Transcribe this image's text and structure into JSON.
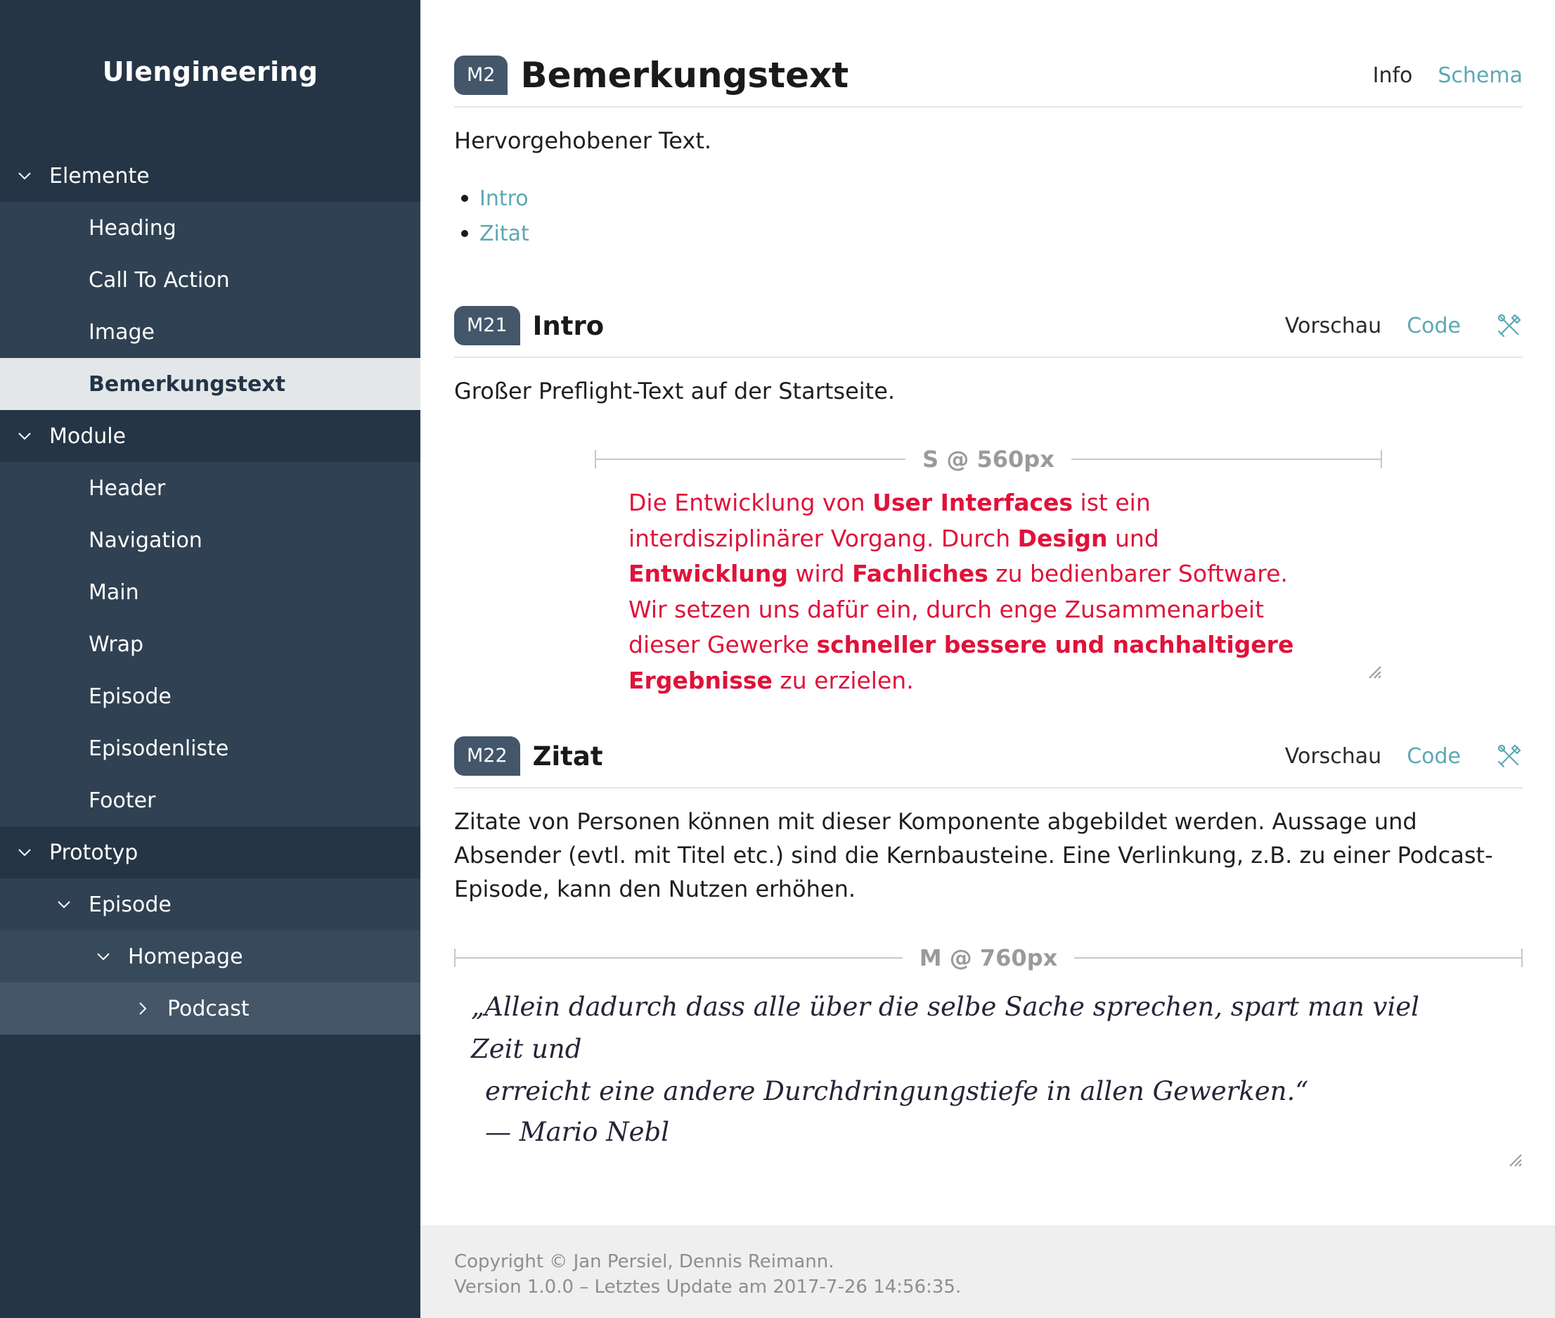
{
  "sidebar": {
    "brand": "UIengineering",
    "items": [
      {
        "label": "Elemente",
        "level": 0,
        "chevron": "down"
      },
      {
        "label": "Heading",
        "level": 1
      },
      {
        "label": "Call To Action",
        "level": 1
      },
      {
        "label": "Image",
        "level": 1
      },
      {
        "label": "Bemerkungstext",
        "level": 1,
        "active": true
      },
      {
        "label": "Module",
        "level": 0,
        "chevron": "down"
      },
      {
        "label": "Header",
        "level": 1
      },
      {
        "label": "Navigation",
        "level": 1
      },
      {
        "label": "Main",
        "level": 1
      },
      {
        "label": "Wrap",
        "level": 1
      },
      {
        "label": "Episode",
        "level": 1
      },
      {
        "label": "Episodenliste",
        "level": 1
      },
      {
        "label": "Footer",
        "level": 1
      },
      {
        "label": "Prototyp",
        "level": 0,
        "chevron": "down"
      },
      {
        "label": "Episode",
        "level": 1,
        "chevron": "down"
      },
      {
        "label": "Homepage",
        "level": 2,
        "chevron": "down"
      },
      {
        "label": "Podcast",
        "level": 3,
        "chevron": "right"
      }
    ]
  },
  "page": {
    "badge": "M2",
    "title": "Bemerkungstext",
    "tab_info": "Info",
    "tab_schema": "Schema",
    "description": "Hervorgehobener Text.",
    "toc": [
      "Intro",
      "Zitat"
    ]
  },
  "intro": {
    "badge": "M21",
    "title": "Intro",
    "preview_label": "Vorschau",
    "code_label": "Code",
    "tool_icon": "tools-icon",
    "description": "Großer Preflight-Text auf der Startseite.",
    "size_label": "S @ 560px",
    "preview": {
      "p1": "Die Entwicklung von ",
      "b1": "User Interfaces",
      "p2": " ist ein interdisziplinärer Vorgang. Durch ",
      "b2": "Design",
      "p3": " und ",
      "b3": "Entwicklung",
      "p4": " wird ",
      "b4": "Fachliches",
      "p5": " zu bedienbarer Software. Wir setzen uns dafür ein, durch enge Zusammenarbeit dieser Gewerke ",
      "b5": "schneller bessere und nachhaltigere Ergebnisse",
      "p6": " zu erzielen."
    }
  },
  "zitat": {
    "badge": "M22",
    "title": "Zitat",
    "preview_label": "Vorschau",
    "code_label": "Code",
    "tool_icon": "tools-icon",
    "description": "Zitate von Personen können mit dieser Komponente abgebildet werden. Aussage und Absender (evtl. mit Titel etc.) sind die Kernbausteine. Eine Verlinkung, z.B. zu einer Podcast-Episode, kann den Nutzen erhöhen.",
    "size_label": "M @ 760px",
    "quote_line1": "„Allein dadurch dass alle über die selbe Sache sprechen, spart man viel Zeit und",
    "quote_line2": "erreicht eine andere Durchdringungstiefe in allen Gewerken.“",
    "quote_author": "— Mario Nebl"
  },
  "footer": {
    "copyright": "Copyright © Jan Persiel, Dennis Reimann.",
    "version": "Version 1.0.0 – Letztes Update am 2017-7-26 14:56:35."
  },
  "colors": {
    "sidebar_bg": "#253545",
    "accent_link": "#5ca8b5",
    "preview_red": "#e0123a",
    "badge_bg": "#43566a"
  }
}
